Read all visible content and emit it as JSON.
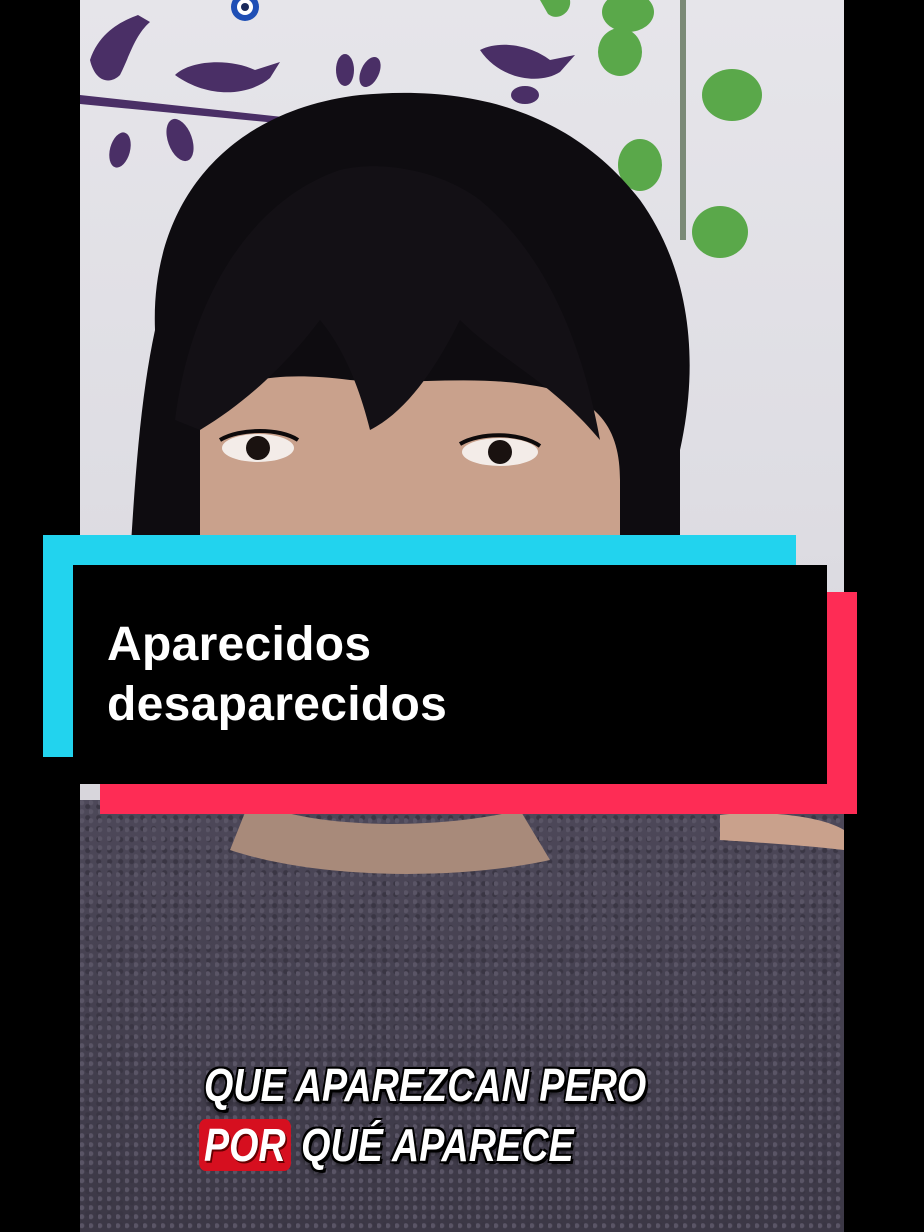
{
  "title_card": {
    "line1": "Aparecidos",
    "line2": "desaparecidos",
    "accent_cyan": "#22d3ee",
    "accent_red": "#fe2c55"
  },
  "subtitles": {
    "line1": "QUE APAREZCAN PERO",
    "line2_highlight": "POR",
    "line2_rest": " QUÉ APARECE",
    "highlight_color": "#d60f1f"
  },
  "scene": {
    "description_icons": [
      "bird-silhouette-icon",
      "evil-eye-icon",
      "ivy-leaf-icon"
    ]
  }
}
